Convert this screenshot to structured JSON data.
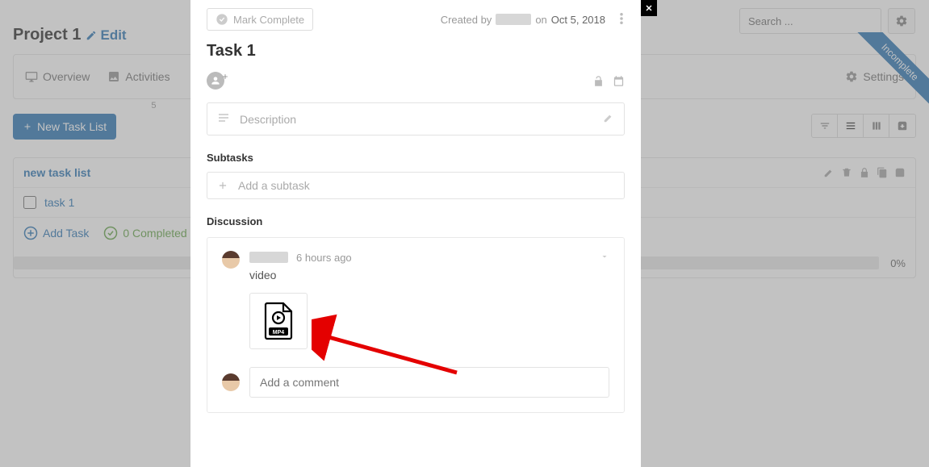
{
  "project": {
    "title": "Project 1",
    "edit_label": "Edit"
  },
  "tabs": {
    "overview": "Overview",
    "activities": "Activities",
    "activities_count": "5",
    "settings": "Settings"
  },
  "search": {
    "placeholder": "Search ..."
  },
  "ribbon": {
    "label": "Incomplete"
  },
  "buttons": {
    "new_task_list": "New Task List"
  },
  "tasklist": {
    "title": "new task list",
    "tasks": [
      {
        "name": "task 1"
      }
    ],
    "add_task_label": "Add Task",
    "completed_label": "0 Completed",
    "progress_pct": "0%"
  },
  "modal": {
    "mark_complete": "Mark Complete",
    "created_prefix": "Created by",
    "created_on": "on",
    "created_date": "Oct 5, 2018",
    "task_title": "Task 1",
    "description_placeholder": "Description",
    "subtasks_heading": "Subtasks",
    "subtask_placeholder": "Add a subtask",
    "discussion_heading": "Discussion",
    "comment_time": "6 hours ago",
    "comment_text": "video",
    "attachment_badge": "MP4",
    "add_comment_placeholder": "Add a comment"
  }
}
